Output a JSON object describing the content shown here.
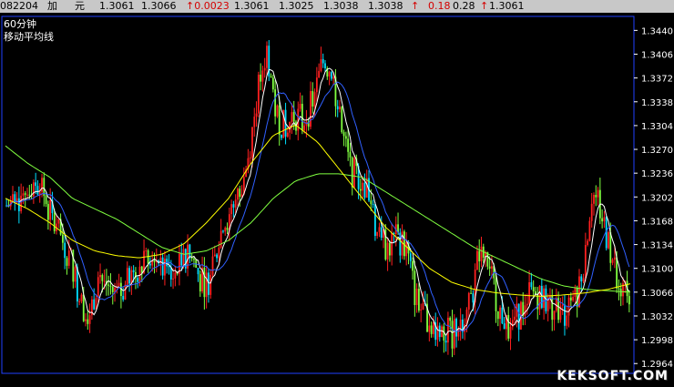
{
  "quote_bar": {
    "code": "082204",
    "name1": "加",
    "name2": "元",
    "last": "1.3061",
    "open": "1.3066",
    "change": "↑0.0023",
    "prev": "1.3061",
    "low": "1.3025",
    "close1": "1.3038",
    "close2": "1.3038",
    "arrow": "↑",
    "pct": "0.18",
    "vol": "0.28",
    "arrow2": "↑",
    "current": "1.3061"
  },
  "overlay": {
    "period": "60分钟",
    "indicator": "移动平均线"
  },
  "watermark": "KEKSOFT.COM",
  "colors": {
    "up": "#ff2020",
    "down": "#00e0ff",
    "ma_white": "#ffffff",
    "ma_yellow": "#ffff00",
    "ma_blue": "#3060ff",
    "ma_green": "#80ff40",
    "frame": "#2040ff"
  },
  "chart_data": {
    "type": "line",
    "title": "",
    "xlabel": "",
    "ylabel": "",
    "ylim": [
      2.995,
      3.346
    ],
    "ylim_note": "",
    "yticks": [
      "1.3440",
      "1.3406",
      "1.3372",
      "1.3338",
      "1.3304",
      "1.3270",
      "1.3236",
      "1.3202",
      "1.3168",
      "1.3134",
      "1.3100",
      "1.3066",
      "1.3032",
      "1.2998",
      "1.2964"
    ],
    "ytick_values": [
      1.344,
      1.3406,
      1.3372,
      1.3338,
      1.3304,
      1.327,
      1.3236,
      1.3202,
      1.3168,
      1.3134,
      1.31,
      1.3066,
      1.3032,
      1.2998,
      1.2964
    ],
    "price_path": [
      1.319,
      1.3195,
      1.3215,
      1.3225,
      1.3205,
      1.3165,
      1.314,
      1.311,
      1.305,
      1.304,
      1.309,
      1.3075,
      1.306,
      1.308,
      1.3095,
      1.313,
      1.312,
      1.3095,
      1.309,
      1.311,
      1.3115,
      1.308,
      1.3085,
      1.315,
      1.318,
      1.32,
      1.326,
      1.335,
      1.3415,
      1.332,
      1.33,
      1.332,
      1.331,
      1.334,
      1.3395,
      1.3385,
      1.33,
      1.324,
      1.323,
      1.321,
      1.314,
      1.313,
      1.3145,
      1.313,
      1.306,
      1.3035,
      1.302,
      1.301,
      1.3005,
      1.303,
      1.305,
      1.314,
      1.31,
      1.304,
      1.302,
      1.303,
      1.306,
      1.3065,
      1.3055,
      1.304,
      1.3035,
      1.3045,
      1.31,
      1.321,
      1.318,
      1.312,
      1.308,
      1.306
    ],
    "series": [
      {
        "color": "#ffffff",
        "period": 5
      },
      {
        "color": "#3060ff",
        "period": 10
      },
      {
        "color": "#80ff40",
        "period": 30
      },
      {
        "color": "#ffff00",
        "period": 60
      }
    ],
    "ma_long_green": [
      1.3275,
      1.325,
      1.323,
      1.32,
      1.3185,
      1.317,
      1.315,
      1.313,
      1.312,
      1.3125,
      1.314,
      1.3165,
      1.32,
      1.3225,
      1.3235,
      1.3235,
      1.323,
      1.321,
      1.319,
      1.317,
      1.315,
      1.313,
      1.3115,
      1.31,
      1.3085,
      1.3075,
      1.307,
      1.3068,
      1.3066
    ],
    "ma_long_yellow": [
      1.32,
      1.3185,
      1.3165,
      1.314,
      1.3125,
      1.3118,
      1.3115,
      1.312,
      1.3135,
      1.3165,
      1.32,
      1.325,
      1.329,
      1.3305,
      1.328,
      1.324,
      1.32,
      1.316,
      1.313,
      1.31,
      1.308,
      1.307,
      1.3065,
      1.3062,
      1.306,
      1.3062,
      1.3065,
      1.307,
      1.3078
    ]
  }
}
